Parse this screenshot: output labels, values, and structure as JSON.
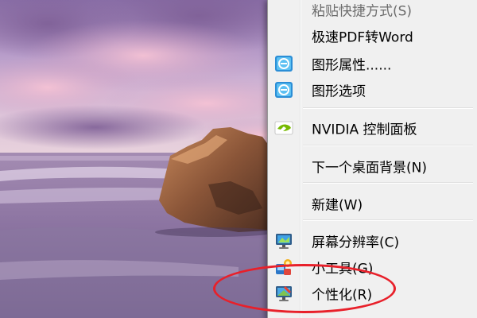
{
  "context_menu": {
    "items": [
      {
        "label": "粘贴快捷方式(S)",
        "icon": null,
        "disabled": true
      },
      {
        "label": "极速PDF转Word",
        "icon": null,
        "disabled": false
      },
      {
        "label": "图形属性......",
        "icon": "intel-graphics-icon",
        "disabled": false
      },
      {
        "label": "图形选项",
        "icon": "intel-graphics-icon",
        "disabled": false
      },
      {
        "label": "NVIDIA 控制面板",
        "icon": "nvidia-icon",
        "disabled": false
      },
      {
        "label": "下一个桌面背景(N)",
        "icon": null,
        "disabled": false
      },
      {
        "label": "新建(W)",
        "icon": null,
        "disabled": false
      },
      {
        "label": "屏幕分辨率(C)",
        "icon": "monitor-resolution-icon",
        "disabled": false
      },
      {
        "label": "小工具(G)",
        "icon": "gadgets-icon",
        "disabled": false
      },
      {
        "label": "个性化(R)",
        "icon": "personalize-icon",
        "disabled": false
      }
    ]
  },
  "annotation": {
    "color": "#e8202a"
  }
}
